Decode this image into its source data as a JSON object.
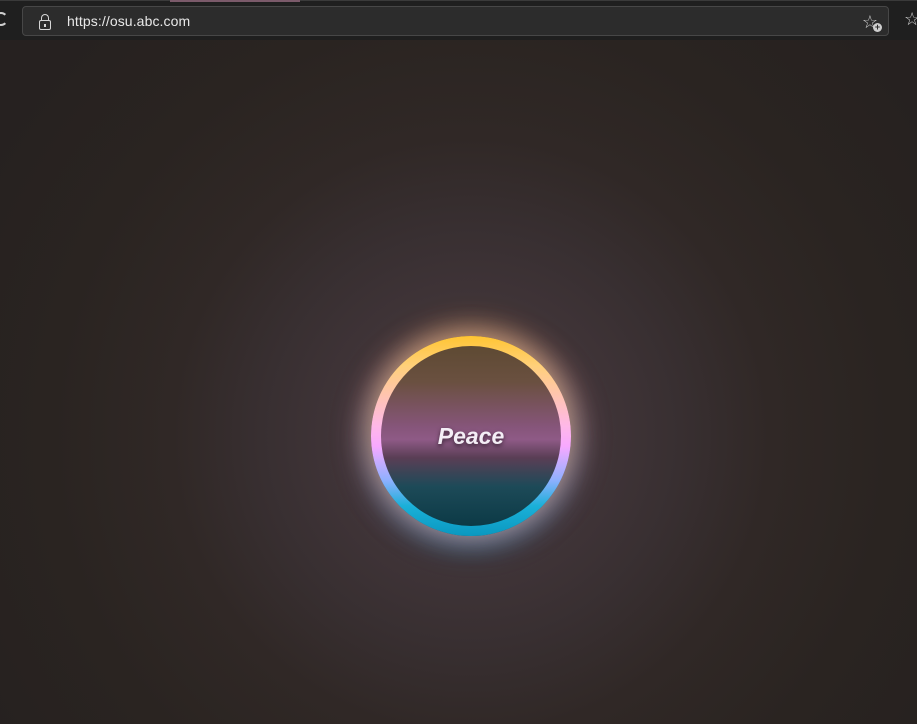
{
  "browser": {
    "url": "https://osu.abc.com",
    "lock_icon": "lock-icon",
    "favorites_icon": "add-favorite-icon",
    "collections_icon": "star-icon",
    "refresh_icon": "refresh-icon"
  },
  "page": {
    "button_label": "Peace",
    "colors": {
      "background": "#2a2420",
      "ring_top": "#ffc533",
      "ring_middle": "#f8a9ff",
      "ring_bottom": "#0a98c0"
    }
  }
}
